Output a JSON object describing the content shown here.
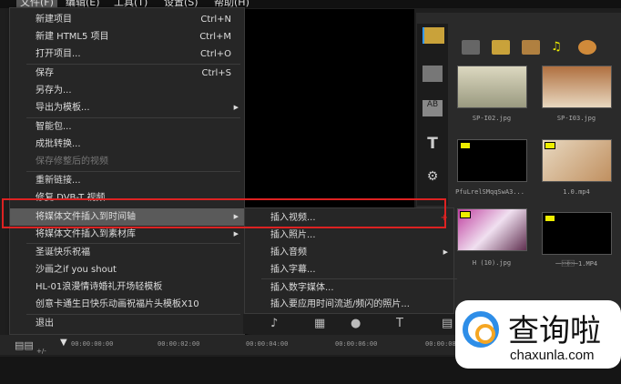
{
  "menubar": [
    "文件(F)",
    "编辑(E)",
    "工具(T)",
    "设置(S)",
    "帮助(H)"
  ],
  "file_menu": [
    {
      "label": "新建项目",
      "shortcut": "Ctrl+N"
    },
    {
      "label": "新建 HTML5 项目",
      "shortcut": "Ctrl+M"
    },
    {
      "label": "打开项目...",
      "shortcut": "Ctrl+O"
    },
    {
      "label": "保存",
      "shortcut": "Ctrl+S"
    },
    {
      "label": "另存为..."
    },
    {
      "label": "导出为模板..."
    },
    {
      "label": "智能包..."
    },
    {
      "label": "成批转换..."
    },
    {
      "label": "保存修整后的视频"
    },
    {
      "label": "重新链接..."
    },
    {
      "label": "修复 DVB-T 视频..."
    },
    {
      "label": "将媒体文件插入到时间轴"
    },
    {
      "label": "将媒体文件插入到素材库"
    },
    {
      "label": "圣诞快乐祝福"
    },
    {
      "label": "沙画之if you shout"
    },
    {
      "label": "HL-01浪漫情诗婚礼开场轻模板"
    },
    {
      "label": "创意卡通生日快乐动画祝福片头模板X10"
    },
    {
      "label": "退出"
    }
  ],
  "submenu": [
    "插入视频...",
    "插入照片...",
    "插入音频",
    "插入字幕...",
    "插入数字媒体...",
    "插入要应用时间流逝/频闪的照片..."
  ],
  "library": {
    "thumbnails": [
      "SP-I02.jpg",
      "SP-I03.jpg",
      "PfuLrelSMqqSwA3...",
      "1.0.mp4",
      "H (10).jpg",
      "一\u0001\u0001~1.MP4"
    ]
  },
  "timeline": {
    "ticks": [
      "00:00:00:00",
      "00:00:02:00",
      "00:00:04:00",
      "00:00:06:00",
      "00:00:08:00"
    ],
    "zoom_label": "+/-"
  },
  "watermark": {
    "brand": "查询啦",
    "url": "chaxunla.com"
  },
  "colors": {
    "highlight_box": "#dd2222",
    "menu_bg": "#262626"
  }
}
